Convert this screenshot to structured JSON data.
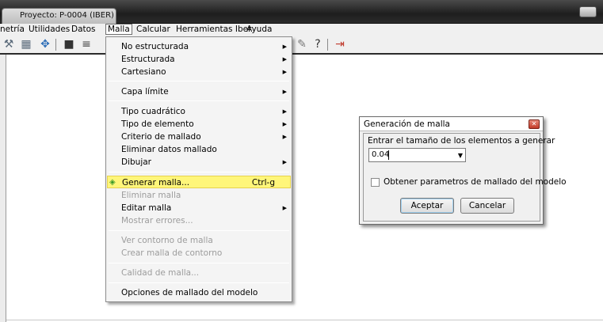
{
  "window": {
    "title": "Proyecto: P-0004 (IBER)"
  },
  "menubar": {
    "items": [
      "netría",
      "Utilidades",
      "Datos",
      "Malla",
      "Calcular",
      "Herramientas Iber",
      "Ayuda"
    ]
  },
  "toolbar": {
    "left_icons": [
      "wrench-icon",
      "mesh-icon",
      "move-icon",
      "camera-icon",
      "print-icon"
    ],
    "right_icons": [
      "draw-icon",
      "help-icon",
      "exit-icon"
    ],
    "help_glyph": "?"
  },
  "menu": {
    "items": [
      {
        "label": "No estructurada",
        "submenu": true,
        "enabled": true
      },
      {
        "label": "Estructurada",
        "submenu": true,
        "enabled": true
      },
      {
        "label": "Cartesiano",
        "submenu": true,
        "enabled": true
      },
      {
        "label": "Capa límite",
        "submenu": true,
        "enabled": true
      },
      {
        "label": "Tipo cuadrático",
        "submenu": true,
        "enabled": true
      },
      {
        "label": "Tipo de elemento",
        "submenu": true,
        "enabled": true
      },
      {
        "label": "Criterio de mallado",
        "submenu": true,
        "enabled": true
      },
      {
        "label": "Eliminar datos mallado",
        "submenu": false,
        "enabled": true
      },
      {
        "label": "Dibujar",
        "submenu": true,
        "enabled": true
      },
      {
        "label": "Generar malla...",
        "shortcut": "Ctrl-g",
        "highlighted": true,
        "enabled": true
      },
      {
        "label": "Eliminar malla",
        "submenu": false,
        "enabled": false
      },
      {
        "label": "Editar malla",
        "submenu": true,
        "enabled": true
      },
      {
        "label": "Mostrar errores...",
        "submenu": false,
        "enabled": false
      },
      {
        "label": "Ver contorno de malla",
        "submenu": false,
        "enabled": false
      },
      {
        "label": "Crear malla de contorno",
        "submenu": false,
        "enabled": false
      },
      {
        "label": "Calidad de malla...",
        "submenu": false,
        "enabled": false
      },
      {
        "label": "Opciones de mallado del modelo",
        "submenu": false,
        "enabled": true
      }
    ],
    "highlight_color": "#fff67a"
  },
  "dialog": {
    "title": "Generación de malla",
    "prompt": "Entrar el tamaño de los elementos a generar",
    "size_value": "0.04",
    "checkbox_label": "Obtener parametros de mallado del modelo",
    "checkbox_checked": false,
    "ok_label": "Aceptar",
    "cancel_label": "Cancelar"
  }
}
